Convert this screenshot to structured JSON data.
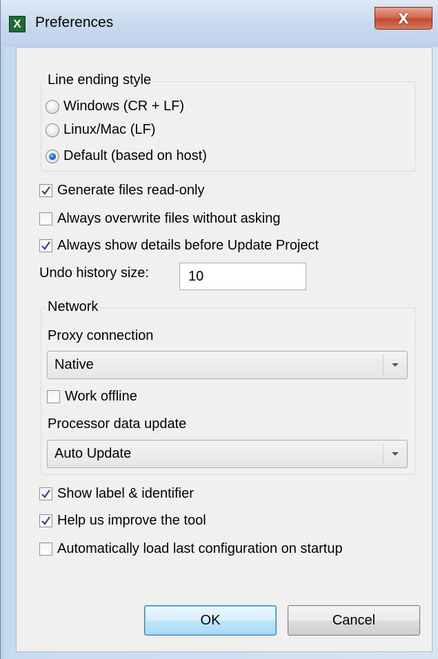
{
  "window": {
    "title": "Preferences",
    "app_icon_letter": "X",
    "close_glyph": "X"
  },
  "line_ending": {
    "title": "Line ending style",
    "options": [
      {
        "label": "Windows (CR + LF)",
        "checked": false
      },
      {
        "label": "Linux/Mac (LF)",
        "checked": false
      },
      {
        "label": "Default (based on host)",
        "checked": true
      }
    ]
  },
  "options_top": [
    {
      "label": "Generate files read-only",
      "checked": true
    },
    {
      "label": "Always overwrite files without asking",
      "checked": false
    },
    {
      "label": "Always show details before Update Project",
      "checked": true
    }
  ],
  "undo": {
    "label": "Undo history size:",
    "value": "10"
  },
  "network": {
    "title": "Network",
    "proxy_label": "Proxy connection",
    "proxy_value": "Native",
    "work_offline_label": "Work offline",
    "work_offline_checked": false,
    "processor_label": "Processor data update",
    "processor_value": "Auto Update"
  },
  "options_bottom": [
    {
      "label": "Show label & identifier",
      "checked": true
    },
    {
      "label": "Help us improve the tool",
      "checked": true
    },
    {
      "label": "Automatically load last configuration on startup",
      "checked": false
    }
  ],
  "buttons": {
    "ok": "OK",
    "cancel": "Cancel"
  },
  "colors": {
    "accent_check": "#2a4a8a",
    "default_button_border": "#3c7fb1",
    "close_button": "#c24a2e"
  }
}
